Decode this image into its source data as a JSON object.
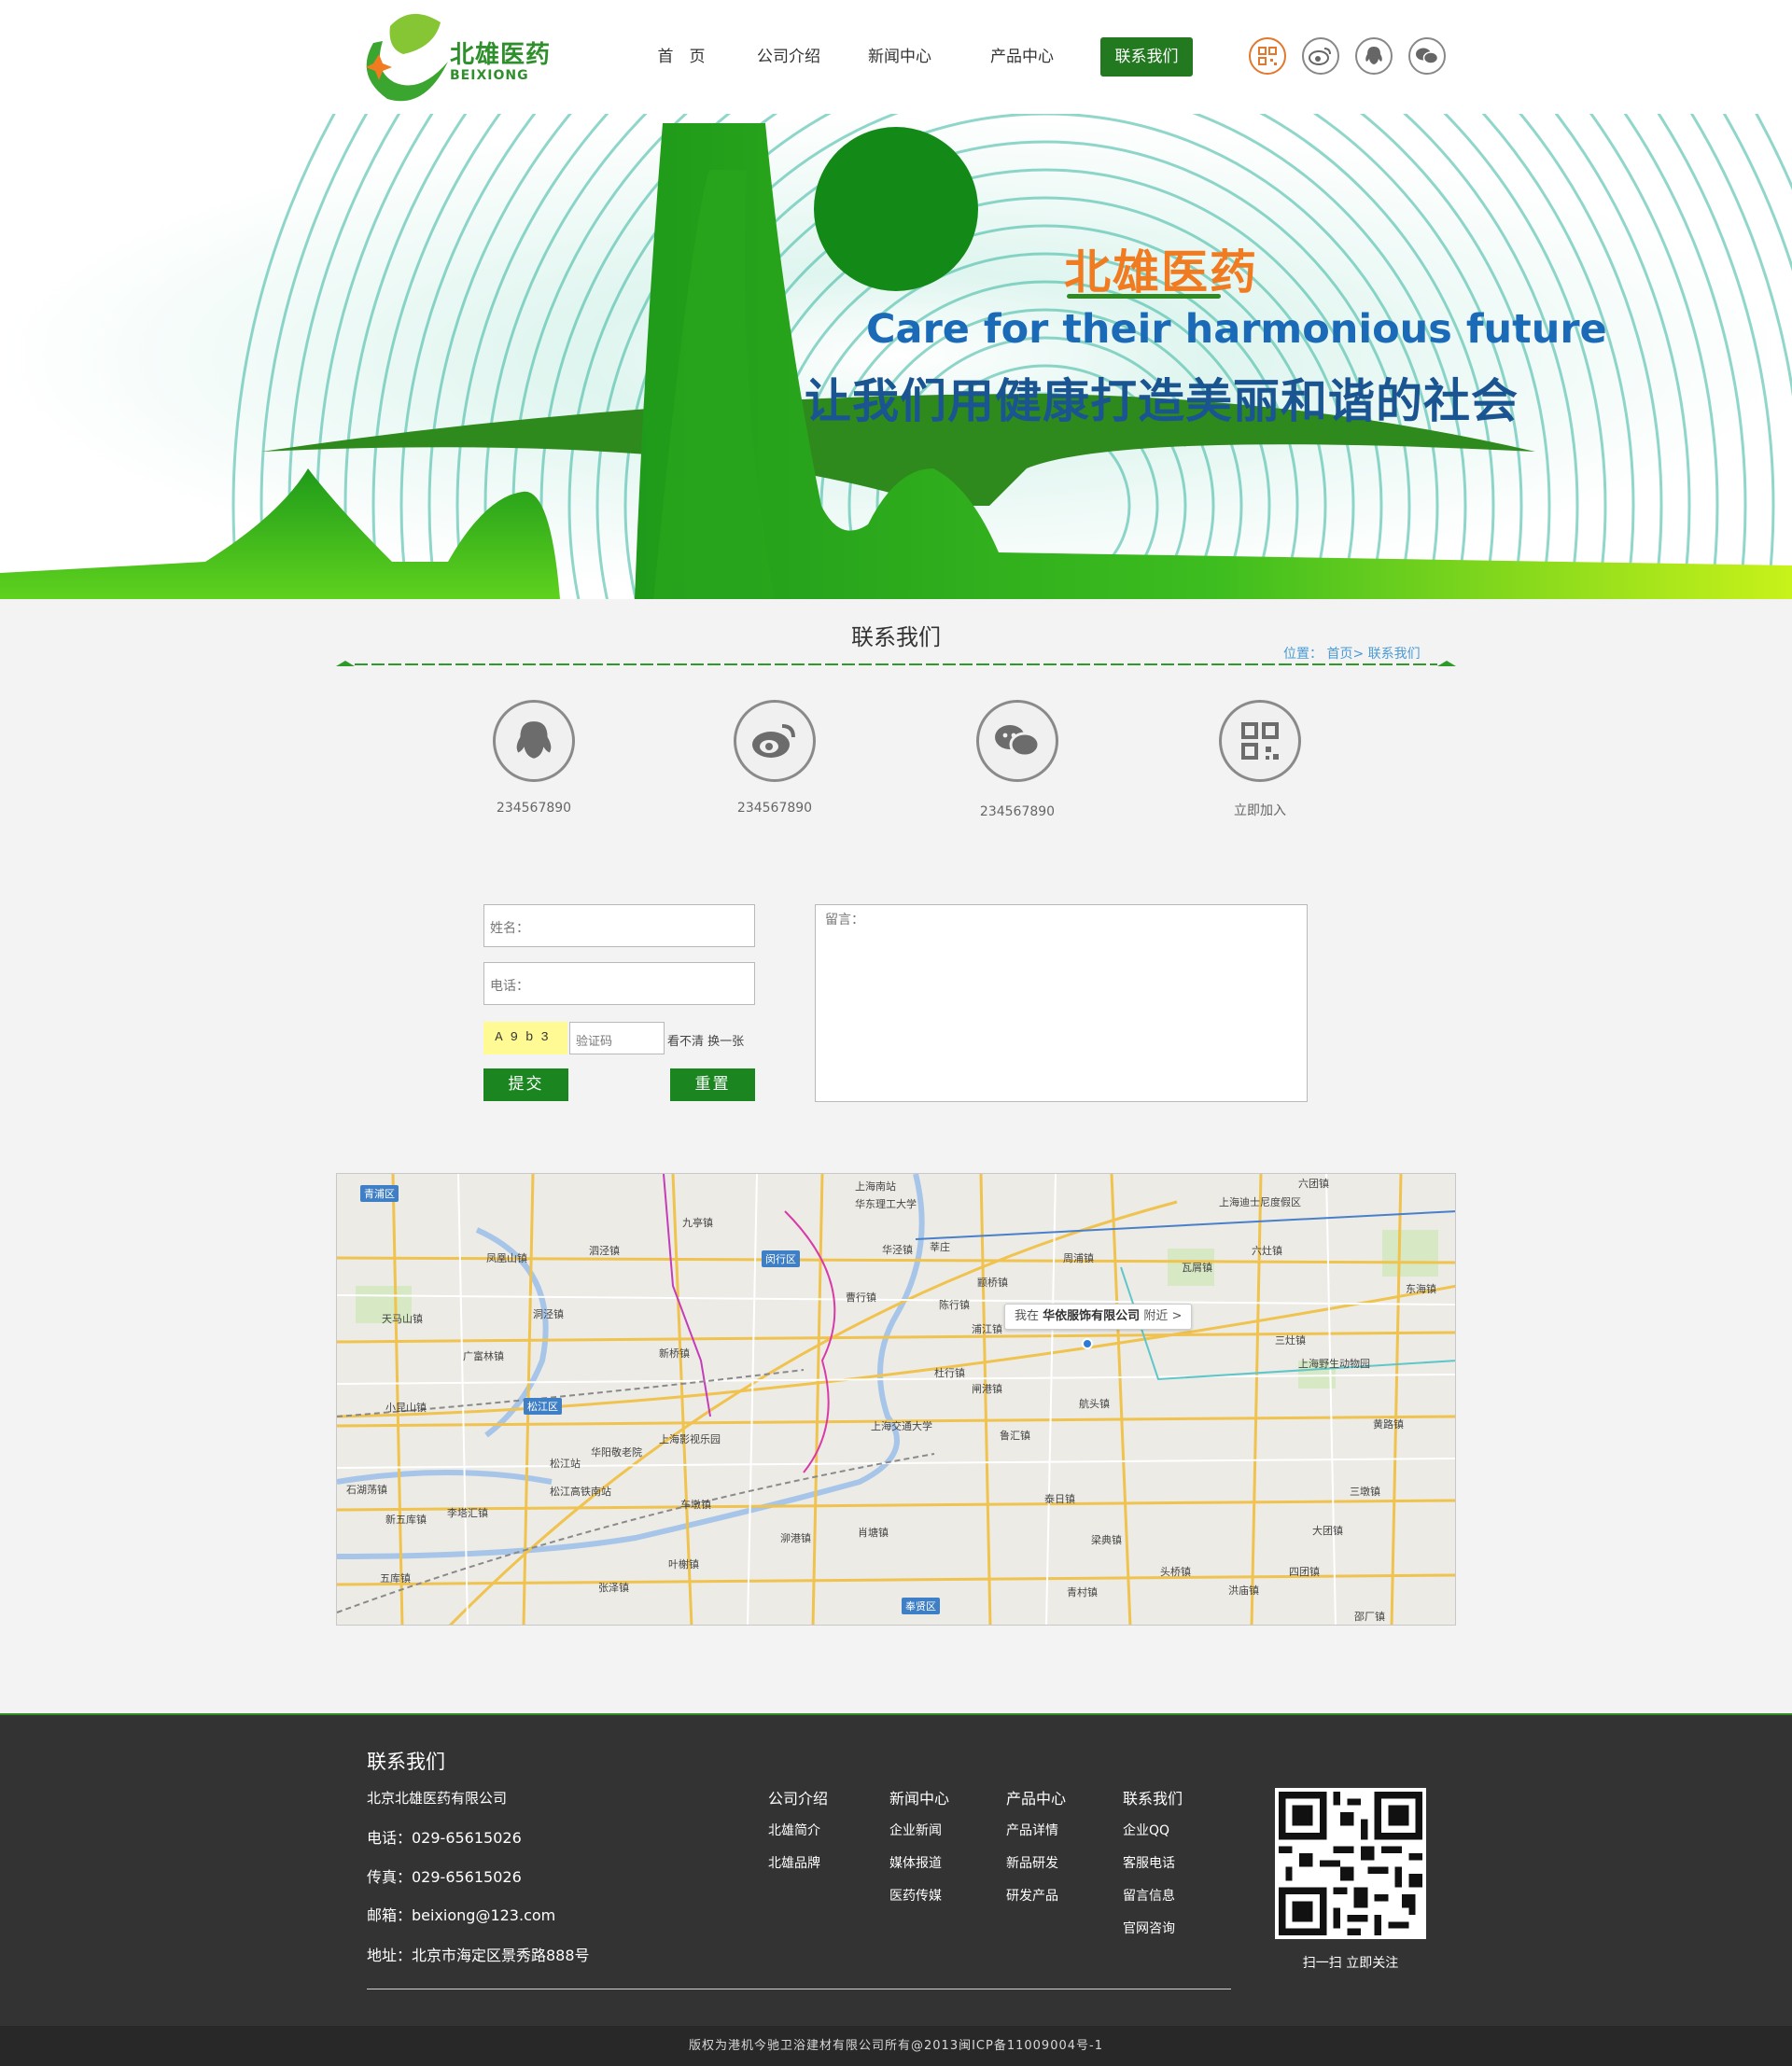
{
  "brand": {
    "name_cn": "北雄医药",
    "name_en": "BEIXIONG",
    "accent_color": "#22791f",
    "orange_color": "#f07b21"
  },
  "nav": {
    "items": [
      {
        "label": "首　页"
      },
      {
        "label": "公司介绍"
      },
      {
        "label": "新闻中心"
      },
      {
        "label": "产品中心"
      },
      {
        "label": "联系我们",
        "active": true
      }
    ]
  },
  "social_icons": [
    "qr-code-icon",
    "weibo-icon",
    "qq-icon",
    "wechat-icon"
  ],
  "banner": {
    "title": "北雄医药",
    "subtitle_en": "Care for their harmonious future",
    "slogan": "让我们用健康打造美丽和谐的社会"
  },
  "section": {
    "title": "联系我们",
    "breadcrumb": "位置： 首页>  联系我们"
  },
  "contacts": [
    {
      "icon": "qq-icon",
      "label": "234567890"
    },
    {
      "icon": "weibo-icon",
      "label": "234567890"
    },
    {
      "icon": "wechat-icon",
      "label": "234567890"
    },
    {
      "icon": "qr-code-icon",
      "label": "立即加入"
    }
  ],
  "form": {
    "name_placeholder": "姓名：",
    "phone_placeholder": "电话：",
    "captcha_text": "A9b3",
    "captcha_placeholder": "验证码",
    "captcha_refresh": "看不清  换一张",
    "submit_label": "提交",
    "reset_label": "重置",
    "message_placeholder": "留言："
  },
  "map": {
    "callout_prefix": "我在",
    "callout_company": "华依服饰有限公司",
    "callout_suffix": "附近 >",
    "districts": [
      "青浦区",
      "闵行区",
      "松江区",
      "奉贤区"
    ],
    "places": [
      "九亭镇",
      "泗泾镇",
      "凤凰山镇",
      "洞泾镇",
      "广富林镇",
      "小昆山镇",
      "天马山镇",
      "新桥镇",
      "华阳敬老院",
      "松江站",
      "松江高铁南站",
      "新五库镇",
      "五库镇",
      "莘庄",
      "曹行镇",
      "颛桥镇",
      "上海交通大学",
      "鲁汇镇",
      "泰日镇",
      "梁典镇",
      "头桥镇",
      "四团镇",
      "大团镇",
      "三墩镇",
      "黄路镇",
      "航头镇",
      "周浦镇",
      "六灶镇",
      "瓦屑镇",
      "三灶镇",
      "上海野生动物园",
      "东海镇",
      "六团镇",
      "上海迪士尼度假区",
      "浦江镇",
      "陈行镇",
      "杜行镇",
      "叶榭镇",
      "张泽镇",
      "车墩镇",
      "泖港镇",
      "上海南站",
      "华东理工大学",
      "华泾镇",
      "闸港镇",
      "肖塘镇",
      "青村镇",
      "洪庙镇",
      "邵厂镇",
      "上海影视乐园",
      "石湖荡镇",
      "李塔汇镇"
    ]
  },
  "footer": {
    "title": "联系我们",
    "company": "北京北雄医药有限公司",
    "phone": "电话：029-65615026",
    "fax": "传真：029-65615026",
    "email": "邮箱：beixiong@123.com",
    "address": "地址：北京市海定区景秀路888号",
    "columns": [
      {
        "head": "公司介绍",
        "items": [
          "北雄简介",
          "北雄品牌"
        ]
      },
      {
        "head": "新闻中心",
        "items": [
          "企业新闻",
          "媒体报道",
          "医药传媒"
        ]
      },
      {
        "head": "产品中心",
        "items": [
          "产品详情",
          "新品研发",
          "研发产品"
        ]
      },
      {
        "head": "联系我们",
        "items": [
          "企业QQ",
          "客服电话",
          "留言信息",
          "官网咨询"
        ]
      }
    ],
    "qr_caption": "扫一扫  立即关注",
    "copyright": "版权为港机今驰卫浴建材有限公司所有@2013闽ICP备11009004号-1"
  }
}
